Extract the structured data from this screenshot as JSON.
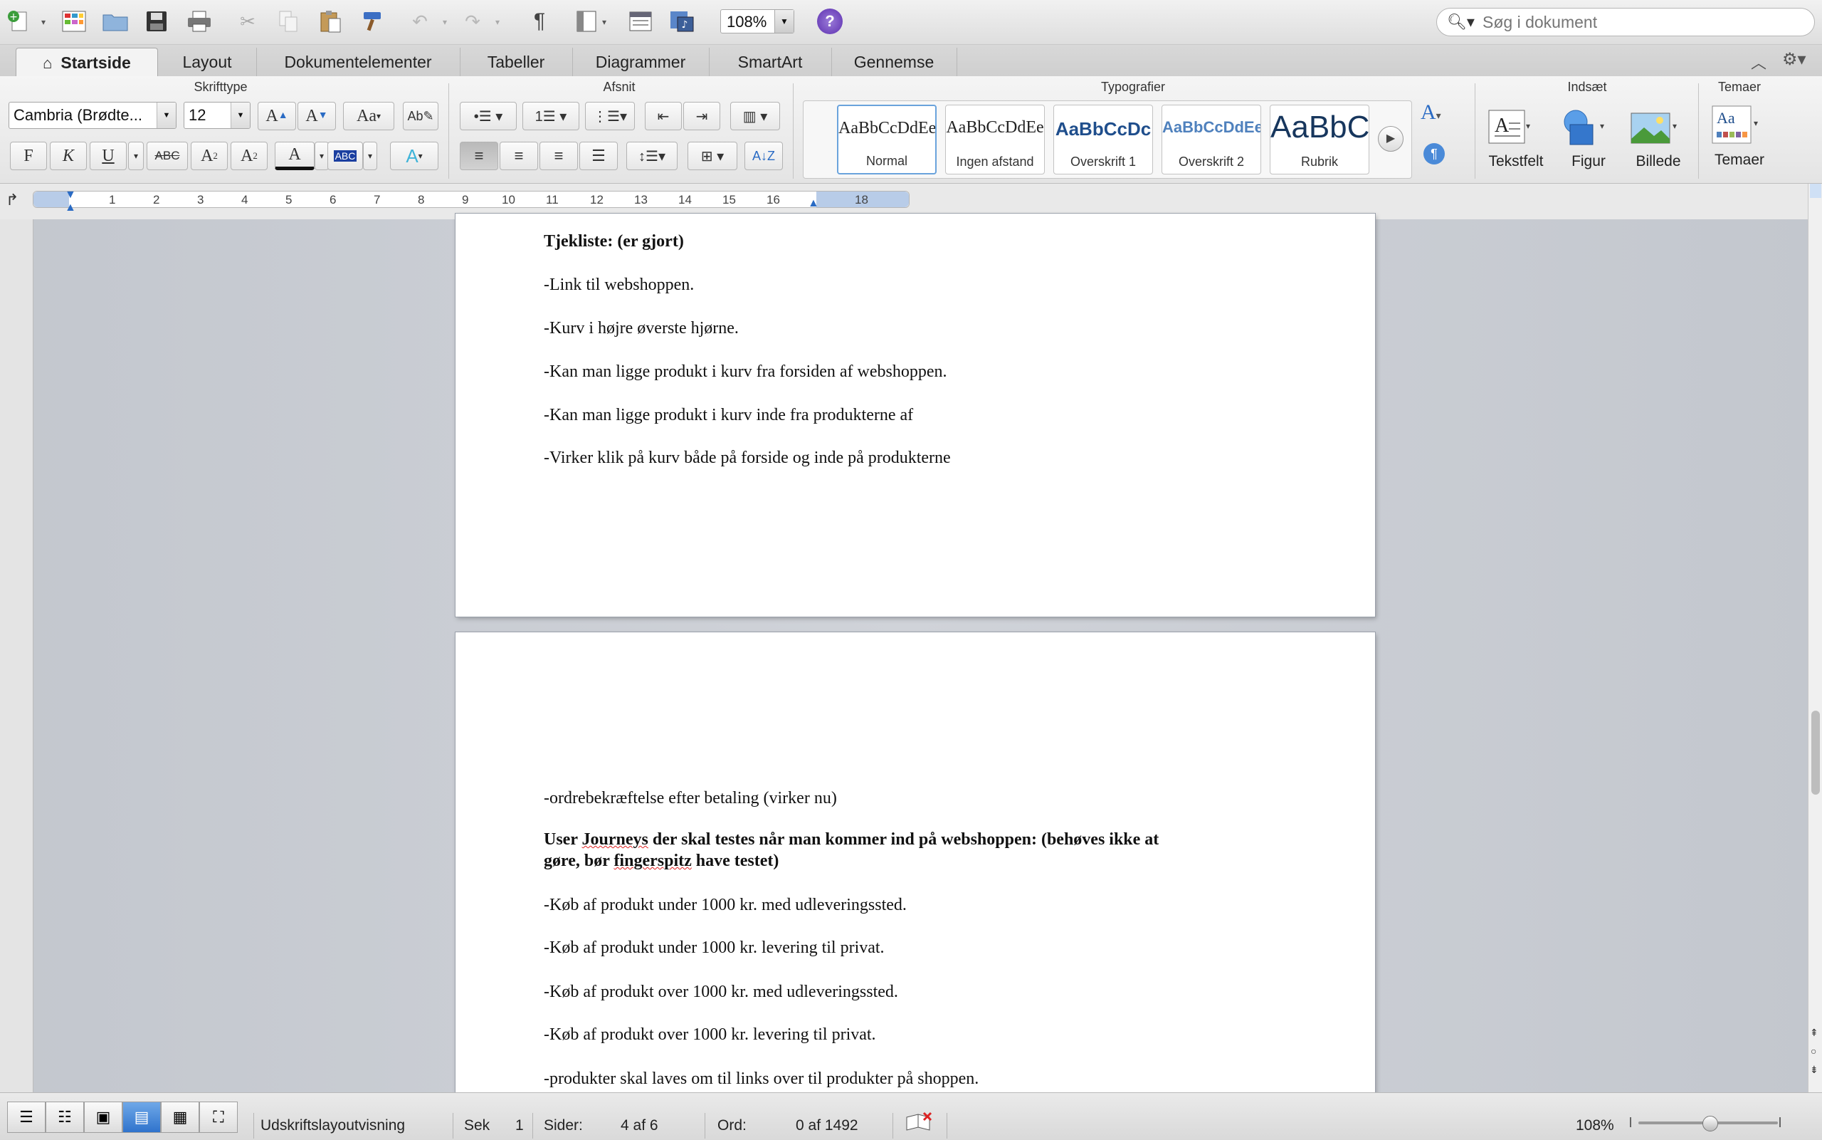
{
  "toolbar": {
    "zoom": "108%",
    "search_placeholder": "Søg i dokument"
  },
  "tabs": [
    {
      "label": "Startside"
    },
    {
      "label": "Layout"
    },
    {
      "label": "Dokumentelementer"
    },
    {
      "label": "Tabeller"
    },
    {
      "label": "Diagrammer"
    },
    {
      "label": "SmartArt"
    },
    {
      "label": "Gennemse"
    }
  ],
  "ribbon": {
    "groups": {
      "font": "Skrifttype",
      "paragraph": "Afsnit",
      "styles": "Typografier",
      "insert": "Indsæt",
      "themes": "Temaer"
    },
    "font_name": "Cambria (Brødte...",
    "font_size": "12",
    "bold": "F",
    "italic": "K",
    "underline": "U",
    "strike": "ABC",
    "styles": [
      {
        "sample": "AaBbCcDdEe",
        "label": "Normal"
      },
      {
        "sample": "AaBbCcDdEe",
        "label": "Ingen afstand"
      },
      {
        "sample": "AaBbCcDc",
        "label": "Overskrift 1"
      },
      {
        "sample": "AaBbCcDdEe",
        "label": "Overskrift 2"
      },
      {
        "sample": "AaBbC",
        "label": "Rubrik"
      }
    ],
    "insert_buttons": {
      "textbox": "Tekstfelt",
      "shape": "Figur",
      "picture": "Billede"
    },
    "themes_button": "Temaer"
  },
  "ruler": [
    "1",
    "2",
    "3",
    "4",
    "5",
    "6",
    "7",
    "8",
    "9",
    "10",
    "11",
    "12",
    "13",
    "14",
    "15",
    "16",
    "18"
  ],
  "page1": {
    "heading": "Tjekliste: (er gjort)",
    "lines": [
      "-Link til webshoppen.",
      "-Kurv i højre øverste hjørne.",
      "-Kan man ligge produkt  i kurv fra forsiden af webshoppen.",
      "-Kan man ligge produkt i kurv inde fra produkterne af",
      "-Virker klik på kurv både på forside og inde på produkterne"
    ]
  },
  "page2": {
    "line_first": "-ordrebekræftelse efter betaling (virker nu)",
    "heading_part1": "User ",
    "heading_word1": "Journeys",
    "heading_part2": " der skal testes når man kommer ind på webshoppen: (behøves ikke at",
    "heading_line2_part1": "gøre, bør ",
    "heading_word2": "fingerspitz",
    "heading_line2_part2": " have testet)",
    "lines": [
      "-Køb af produkt under 1000 kr. med udleveringssted.",
      "-Køb af produkt under 1000 kr. levering til privat.",
      "-Køb af produkt over 1000 kr. med udleveringssted.",
      "-Køb af produkt over 1000 kr. levering til privat.",
      "-produkter skal laves om til links over til produkter på shoppen."
    ]
  },
  "status": {
    "view_name": "Udskriftslayoutvisning",
    "section_label": "Sek",
    "section_value": "1",
    "pages_label": "Sider:",
    "pages_value": "4 af 6",
    "words_label": "Ord:",
    "words_value": "0 af 1492",
    "zoom": "108%"
  },
  "colors": {
    "accent": "#2f73cc",
    "doc_background": "#c8ccd3",
    "spell_error": "#e02020"
  }
}
